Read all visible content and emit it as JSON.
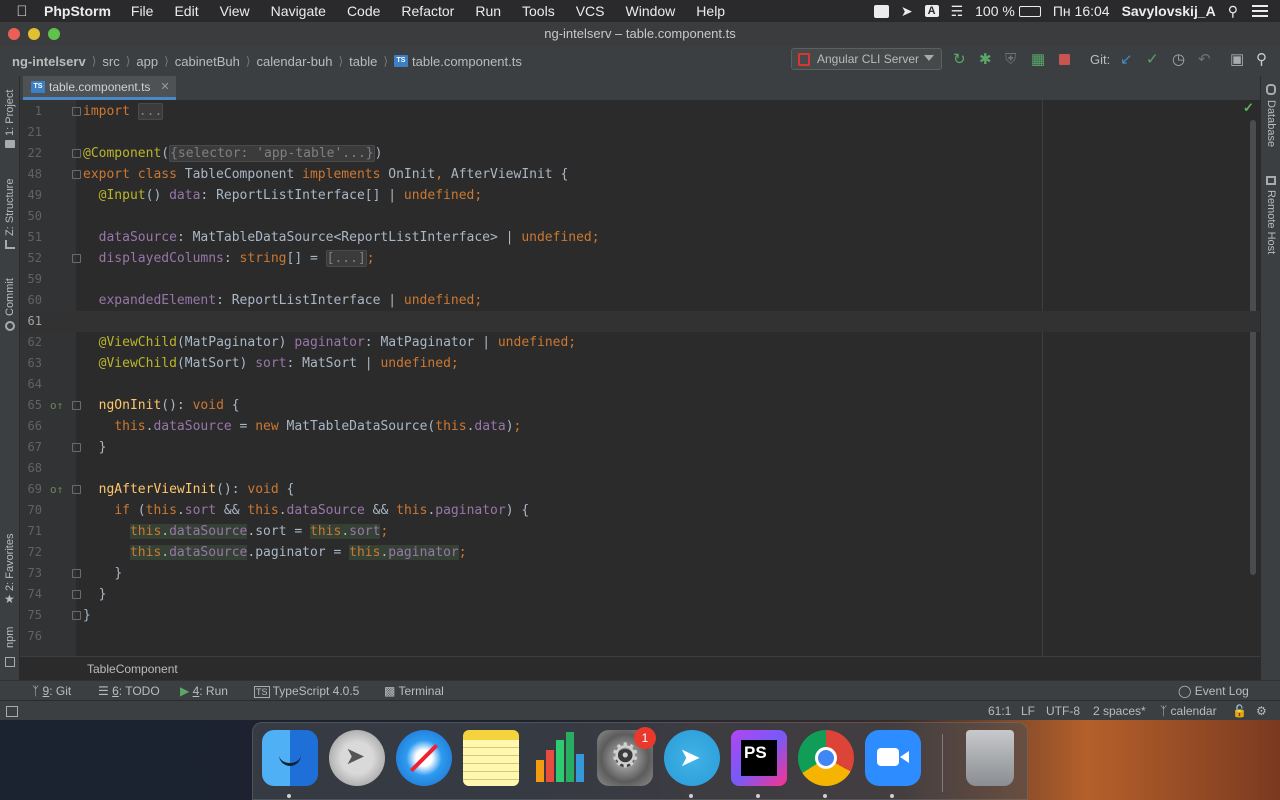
{
  "menubar": {
    "app_name": "PhpStorm",
    "items": [
      "File",
      "Edit",
      "View",
      "Navigate",
      "Code",
      "Refactor",
      "Run",
      "Tools",
      "VCS",
      "Window",
      "Help"
    ],
    "battery": "100 %",
    "clock": "Пн 16:04",
    "user": "Savylovskij_A",
    "input_source": "A"
  },
  "window": {
    "title": "ng-intelserv – table.component.ts"
  },
  "breadcrumb": [
    "ng-intelserv",
    "src",
    "app",
    "cabinetBuh",
    "calendar-buh",
    "table",
    "table.component.ts"
  ],
  "toolbar": {
    "run_config": "Angular CLI Server",
    "git_label": "Git:"
  },
  "tab": {
    "label": "table.component.ts",
    "badge": "TS"
  },
  "side_tabs": {
    "left": [
      "1: Project",
      "Z: Structure",
      "Commit",
      "2: Favorites",
      "npm"
    ],
    "right": [
      "Database",
      "Remote Host"
    ]
  },
  "editor": {
    "current_line": "61",
    "lines": [
      {
        "n": "1",
        "text": "import ..."
      },
      {
        "n": "21",
        "text": ""
      },
      {
        "n": "22",
        "text": "@Component({selector: 'app-table'...})"
      },
      {
        "n": "48",
        "text": "export class TableComponent implements OnInit, AfterViewInit {"
      },
      {
        "n": "49",
        "text": "  @Input() data: ReportListInterface[] | undefined;"
      },
      {
        "n": "50",
        "text": ""
      },
      {
        "n": "51",
        "text": "  dataSource: MatTableDataSource<ReportListInterface> | undefined;"
      },
      {
        "n": "52",
        "text": "  displayedColumns: string[] = [...];"
      },
      {
        "n": "59",
        "text": ""
      },
      {
        "n": "60",
        "text": "  expandedElement: ReportListInterface | undefined;"
      },
      {
        "n": "61",
        "text": ""
      },
      {
        "n": "62",
        "text": "  @ViewChild(MatPaginator) paginator: MatPaginator | undefined;"
      },
      {
        "n": "63",
        "text": "  @ViewChild(MatSort) sort: MatSort | undefined;"
      },
      {
        "n": "64",
        "text": ""
      },
      {
        "n": "65",
        "text": "  ngOnInit(): void {"
      },
      {
        "n": "66",
        "text": "    this.dataSource = new MatTableDataSource(this.data);"
      },
      {
        "n": "67",
        "text": "  }"
      },
      {
        "n": "68",
        "text": ""
      },
      {
        "n": "69",
        "text": "  ngAfterViewInit(): void {"
      },
      {
        "n": "70",
        "text": "    if (this.sort && this.dataSource && this.paginator) {"
      },
      {
        "n": "71",
        "text": "      this.dataSource.sort = this.sort;"
      },
      {
        "n": "72",
        "text": "      this.dataSource.paginator = this.paginator;"
      },
      {
        "n": "73",
        "text": "    }"
      },
      {
        "n": "74",
        "text": "  }"
      },
      {
        "n": "75",
        "text": "}"
      },
      {
        "n": "76",
        "text": ""
      }
    ]
  },
  "code_breadcrumb": "TableComponent",
  "tool_windows": [
    {
      "num": "9",
      "label": ": Git"
    },
    {
      "num": "6",
      "label": ": TODO"
    },
    {
      "num": "4",
      "label": ": Run"
    },
    {
      "num": "",
      "label": "TypeScript 4.0.5"
    },
    {
      "num": "",
      "label": "Terminal"
    }
  ],
  "event_log": "Event Log",
  "status": {
    "position": "61:1",
    "line_sep": "LF",
    "encoding": "UTF-8",
    "indent": "2 spaces*",
    "branch": "calendar"
  },
  "dock": {
    "apps": [
      "Finder",
      "Launchpad",
      "Safari",
      "Notes",
      "Numbers",
      "System Preferences",
      "Telegram",
      "PhpStorm",
      "Chrome",
      "Zoom",
      "Trash"
    ],
    "sysprefs_badge": "1",
    "phpstorm_icon_text": "PS"
  }
}
